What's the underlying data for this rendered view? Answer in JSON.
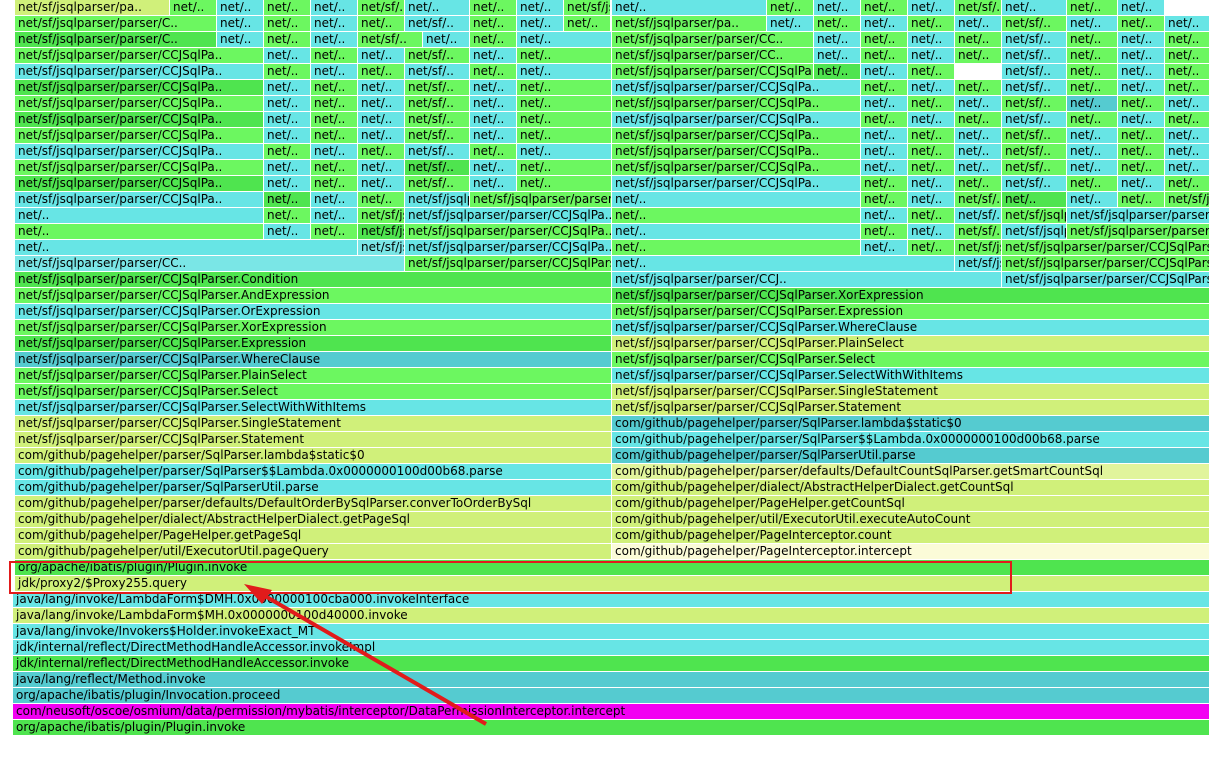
{
  "palette": {
    "lime": "#6cf760",
    "lime2": "#4fe44f",
    "cyan": "#67e5e5",
    "teal": "#55cbd0",
    "cyan2": "#7ae6e6",
    "yellow": "#d0f07a",
    "yellow2": "#e1f49c",
    "cream": "#fbfbd8",
    "magenta": "#f200f2"
  },
  "highlight_color": "#e11b1b",
  "frames": [
    {
      "t": "net/sf/jsqlparser/pa..",
      "c": "yellow"
    },
    {
      "t": "net/..",
      "c": "lime"
    },
    {
      "t": "net/..",
      "c": "cyan"
    },
    {
      "t": "net/..",
      "c": "lime"
    },
    {
      "t": "net/..",
      "c": "cyan"
    },
    {
      "t": "net/sf/..",
      "c": "lime"
    },
    {
      "t": "net/..",
      "c": "cyan"
    },
    {
      "t": "net/..",
      "c": "lime"
    },
    {
      "t": "net/..",
      "c": "cyan"
    },
    {
      "t": "net/sf/jsqlparser/pa..",
      "c": "lime"
    },
    {
      "t": "net/..",
      "c": "cyan"
    },
    {
      "t": "net/..",
      "c": "lime"
    },
    {
      "t": "net/..",
      "c": "cyan"
    },
    {
      "t": "net/..",
      "c": "lime"
    },
    {
      "t": "net/..",
      "c": "cyan"
    },
    {
      "t": "net/sf/..",
      "c": "lime"
    },
    {
      "t": "net/..",
      "c": "cyan"
    },
    {
      "t": "net/..",
      "c": "lime"
    },
    {
      "t": "net/..",
      "c": "cyan"
    },
    {
      "t": "net/sf/jsqlparser/parser/C..",
      "c": "lime"
    },
    {
      "t": "net/..",
      "c": "cyan"
    },
    {
      "t": "net/..",
      "c": "lime"
    },
    {
      "t": "net/..",
      "c": "cyan"
    },
    {
      "t": "net/..",
      "c": "lime"
    },
    {
      "t": "net/sf/..",
      "c": "cyan"
    },
    {
      "t": "net/..",
      "c": "lime"
    },
    {
      "t": "net/..",
      "c": "cyan"
    },
    {
      "t": "net/..",
      "c": "lime"
    },
    {
      "t": "net/sf/jsqlparser/pa..",
      "c": "lime"
    },
    {
      "t": "net/..",
      "c": "cyan"
    },
    {
      "t": "net/..",
      "c": "lime"
    },
    {
      "t": "net/..",
      "c": "cyan"
    },
    {
      "t": "net/..",
      "c": "lime"
    },
    {
      "t": "net/..",
      "c": "cyan"
    },
    {
      "t": "net/sf/..",
      "c": "lime"
    },
    {
      "t": "net/..",
      "c": "cyan"
    },
    {
      "t": "net/..",
      "c": "lime"
    },
    {
      "t": "net/..",
      "c": "cyan"
    },
    {
      "t": "net/sf/jsqlparser/parser/C..",
      "c": "lime2"
    },
    {
      "t": "net/..",
      "c": "cyan"
    },
    {
      "t": "net/..",
      "c": "lime"
    },
    {
      "t": "net/..",
      "c": "cyan"
    },
    {
      "t": "net/sf/..",
      "c": "lime"
    },
    {
      "t": "net/..",
      "c": "cyan"
    },
    {
      "t": "net/..",
      "c": "lime"
    },
    {
      "t": "net/..",
      "c": "cyan"
    },
    {
      "t": "net/sf/jsqlparser/parser/CC..",
      "c": "lime"
    },
    {
      "t": "net/..",
      "c": "cyan"
    },
    {
      "t": "net/..",
      "c": "lime"
    },
    {
      "t": "net/..",
      "c": "cyan"
    },
    {
      "t": "net/..",
      "c": "lime"
    },
    {
      "t": "net/sf/..",
      "c": "cyan"
    },
    {
      "t": "net/..",
      "c": "lime"
    },
    {
      "t": "net/..",
      "c": "cyan"
    },
    {
      "t": "net/..",
      "c": "lime"
    },
    {
      "t": "net/sf/jsqlparser/parser/CCJSqlPa..",
      "c": "lime"
    },
    {
      "t": "net/..",
      "c": "cyan"
    },
    {
      "t": "net/..",
      "c": "lime"
    },
    {
      "t": "net/..",
      "c": "cyan"
    },
    {
      "t": "net/sf/..",
      "c": "lime"
    },
    {
      "t": "net/..",
      "c": "cyan"
    },
    {
      "t": "net/..",
      "c": "lime"
    },
    {
      "t": "net/sf/jsqlparser/parser/CC..",
      "c": "lime"
    },
    {
      "t": "net/..",
      "c": "cyan"
    },
    {
      "t": "net/..",
      "c": "lime"
    },
    {
      "t": "net/..",
      "c": "cyan"
    },
    {
      "t": "net/..",
      "c": "lime"
    },
    {
      "t": "net/sf/..",
      "c": "cyan"
    },
    {
      "t": "net/..",
      "c": "lime"
    },
    {
      "t": "net/..",
      "c": "cyan"
    },
    {
      "t": "net/..",
      "c": "lime"
    },
    {
      "t": "net/sf/jsqlparser/parser/CCJSqlPa..",
      "c": "cyan"
    },
    {
      "t": "net/..",
      "c": "lime"
    },
    {
      "t": "net/..",
      "c": "cyan"
    },
    {
      "t": "net/..",
      "c": "lime"
    },
    {
      "t": "net/sf/..",
      "c": "cyan"
    },
    {
      "t": "net/..",
      "c": "lime"
    },
    {
      "t": "net/..",
      "c": "cyan"
    },
    {
      "t": "net/sf/jsqlparser/parser/CCJSqlPa..",
      "c": "lime"
    },
    {
      "t": "net/..",
      "c": "lime2"
    },
    {
      "t": "net/..",
      "c": "cyan"
    },
    {
      "t": "net/..",
      "c": "lime"
    },
    {
      "t": "net/sf/..",
      "c": "cyan"
    },
    {
      "t": "net/..",
      "c": "lime"
    },
    {
      "t": "net/..",
      "c": "cyan"
    },
    {
      "t": "net/..",
      "c": "lime"
    },
    {
      "t": "net/sf/jsqlparser/parser/CCJSqlPa..",
      "c": "lime2"
    },
    {
      "t": "net/..",
      "c": "cyan"
    },
    {
      "t": "net/..",
      "c": "lime"
    },
    {
      "t": "net/..",
      "c": "cyan"
    },
    {
      "t": "net/sf/..",
      "c": "lime"
    },
    {
      "t": "net/..",
      "c": "cyan"
    },
    {
      "t": "net/..",
      "c": "lime"
    },
    {
      "t": "net/sf/jsqlparser/parser/CCJSqlPa..",
      "c": "cyan"
    },
    {
      "t": "net/..",
      "c": "lime"
    },
    {
      "t": "net/..",
      "c": "cyan"
    },
    {
      "t": "net/..",
      "c": "lime"
    },
    {
      "t": "net/sf/..",
      "c": "cyan"
    },
    {
      "t": "net/..",
      "c": "lime"
    },
    {
      "t": "net/..",
      "c": "cyan"
    },
    {
      "t": "net/..",
      "c": "lime"
    },
    {
      "t": "net/sf/jsqlparser/parser/CCJSqlPa..",
      "c": "lime"
    },
    {
      "t": "net/..",
      "c": "cyan"
    },
    {
      "t": "net/..",
      "c": "lime"
    },
    {
      "t": "net/..",
      "c": "cyan"
    },
    {
      "t": "net/sf/..",
      "c": "lime"
    },
    {
      "t": "net/..",
      "c": "cyan"
    },
    {
      "t": "net/..",
      "c": "lime"
    },
    {
      "t": "net/sf/jsqlparser/parser/CCJSqlPa..",
      "c": "lime"
    },
    {
      "t": "net/..",
      "c": "cyan"
    },
    {
      "t": "net/..",
      "c": "lime"
    },
    {
      "t": "net/..",
      "c": "cyan"
    },
    {
      "t": "net/sf/..",
      "c": "lime"
    },
    {
      "t": "net/..",
      "c": "teal"
    },
    {
      "t": "net/..",
      "c": "lime"
    },
    {
      "t": "net/..",
      "c": "cyan"
    },
    {
      "t": "net/sf/jsqlparser/parser/CCJSqlPa..",
      "c": "lime2"
    },
    {
      "t": "net/..",
      "c": "cyan"
    },
    {
      "t": "net/..",
      "c": "lime"
    },
    {
      "t": "net/..",
      "c": "cyan"
    },
    {
      "t": "net/sf/..",
      "c": "lime"
    },
    {
      "t": "net/..",
      "c": "cyan"
    },
    {
      "t": "net/..",
      "c": "lime"
    },
    {
      "t": "net/sf/jsqlparser/parser/CCJSqlPa..",
      "c": "cyan"
    },
    {
      "t": "net/..",
      "c": "lime"
    },
    {
      "t": "net/..",
      "c": "cyan"
    },
    {
      "t": "net/..",
      "c": "lime"
    },
    {
      "t": "net/sf/..",
      "c": "cyan"
    },
    {
      "t": "net/..",
      "c": "lime"
    },
    {
      "t": "net/..",
      "c": "cyan"
    },
    {
      "t": "net/..",
      "c": "lime"
    },
    {
      "t": "net/sf/jsqlparser/parser/CCJSqlPa..",
      "c": "lime"
    },
    {
      "t": "net/..",
      "c": "cyan"
    },
    {
      "t": "net/..",
      "c": "lime"
    },
    {
      "t": "net/..",
      "c": "cyan"
    },
    {
      "t": "net/sf/..",
      "c": "lime"
    },
    {
      "t": "net/..",
      "c": "cyan"
    },
    {
      "t": "net/..",
      "c": "lime"
    },
    {
      "t": "net/sf/jsqlparser/parser/CCJSqlPa..",
      "c": "lime"
    },
    {
      "t": "net/..",
      "c": "cyan"
    },
    {
      "t": "net/..",
      "c": "lime"
    },
    {
      "t": "net/..",
      "c": "cyan"
    },
    {
      "t": "net/sf/..",
      "c": "lime"
    },
    {
      "t": "net/..",
      "c": "cyan"
    },
    {
      "t": "net/..",
      "c": "lime"
    },
    {
      "t": "net/..",
      "c": "cyan"
    },
    {
      "t": "net/sf/jsqlparser/parser/CCJSqlPa..",
      "c": "cyan"
    },
    {
      "t": "net/..",
      "c": "lime"
    },
    {
      "t": "net/..",
      "c": "cyan"
    },
    {
      "t": "net/..",
      "c": "lime"
    },
    {
      "t": "net/sf/..",
      "c": "cyan"
    },
    {
      "t": "net/..",
      "c": "lime"
    },
    {
      "t": "net/..",
      "c": "cyan"
    },
    {
      "t": "net/sf/jsqlparser/parser/CCJSqlPa..",
      "c": "lime"
    },
    {
      "t": "net/..",
      "c": "cyan"
    },
    {
      "t": "net/..",
      "c": "lime"
    },
    {
      "t": "net/..",
      "c": "cyan"
    },
    {
      "t": "net/sf/..",
      "c": "lime"
    },
    {
      "t": "net/..",
      "c": "cyan"
    },
    {
      "t": "net/..",
      "c": "lime"
    },
    {
      "t": "net/..",
      "c": "cyan"
    },
    {
      "t": "net/sf/jsqlparser/parser/CCJSqlPa..",
      "c": "lime"
    },
    {
      "t": "net/..",
      "c": "cyan"
    },
    {
      "t": "net/..",
      "c": "lime"
    },
    {
      "t": "net/..",
      "c": "cyan"
    },
    {
      "t": "net/sf/..",
      "c": "lime2"
    },
    {
      "t": "net/..",
      "c": "cyan"
    },
    {
      "t": "net/..",
      "c": "lime"
    },
    {
      "t": "net/sf/jsqlparser/parser/CCJSqlPa..",
      "c": "lime"
    },
    {
      "t": "net/..",
      "c": "cyan"
    },
    {
      "t": "net/..",
      "c": "lime"
    },
    {
      "t": "net/..",
      "c": "cyan"
    },
    {
      "t": "net/sf/..",
      "c": "lime"
    },
    {
      "t": "net/..",
      "c": "cyan"
    },
    {
      "t": "net/..",
      "c": "lime"
    },
    {
      "t": "net/..",
      "c": "cyan"
    },
    {
      "t": "net/sf/jsqlparser/parser/CCJSqlPa..",
      "c": "lime2"
    },
    {
      "t": "net/..",
      "c": "cyan"
    },
    {
      "t": "net/..",
      "c": "lime"
    },
    {
      "t": "net/..",
      "c": "cyan"
    },
    {
      "t": "net/sf/..",
      "c": "lime"
    },
    {
      "t": "net/..",
      "c": "cyan"
    },
    {
      "t": "net/..",
      "c": "lime"
    },
    {
      "t": "net/sf/jsqlparser/parser/CCJSqlPa..",
      "c": "cyan"
    },
    {
      "t": "net/..",
      "c": "lime"
    },
    {
      "t": "net/..",
      "c": "cyan"
    },
    {
      "t": "net/..",
      "c": "lime"
    },
    {
      "t": "net/sf/..",
      "c": "cyan"
    },
    {
      "t": "net/..",
      "c": "lime"
    },
    {
      "t": "net/..",
      "c": "cyan"
    },
    {
      "t": "net/..",
      "c": "lime"
    },
    {
      "t": "net/sf/jsqlparser/parser/CCJSqlPa..",
      "c": "cyan"
    },
    {
      "t": "net/..",
      "c": "lime2"
    },
    {
      "t": "net/..",
      "c": "cyan"
    },
    {
      "t": "net/..",
      "c": "lime"
    },
    {
      "t": "net/sf/jsqlparser/..",
      "c": "cyan"
    },
    {
      "t": "net/sf/jsqlparser/parser/CCJSqlPa..",
      "c": "lime"
    },
    {
      "t": "net/..",
      "c": "cyan"
    },
    {
      "t": "net/..",
      "c": "lime"
    },
    {
      "t": "net/..",
      "c": "cyan"
    },
    {
      "t": "net/sf/..",
      "c": "lime"
    },
    {
      "t": "net/..",
      "c": "lime2"
    },
    {
      "t": "net/..",
      "c": "cyan"
    },
    {
      "t": "net/..",
      "c": "lime"
    },
    {
      "t": "net/sf/jsqlparser/parser/CCJSqlPa..",
      "c": "lime"
    },
    {
      "t": "net/..",
      "c": "cyan"
    },
    {
      "t": "net/..",
      "c": "lime"
    },
    {
      "t": "net/..",
      "c": "cyan"
    },
    {
      "t": "net/sf/jsqlparser/parser/C..",
      "c": "lime"
    },
    {
      "t": "net/sf/jsqlparser/parser/CCJSqlPa..",
      "c": "cyan"
    },
    {
      "t": "net/..",
      "c": "lime"
    },
    {
      "t": "net/..",
      "c": "cyan"
    },
    {
      "t": "net/..",
      "c": "lime"
    },
    {
      "t": "net/sf/..",
      "c": "cyan"
    },
    {
      "t": "net/sf/jsqlparser/..",
      "c": "lime"
    },
    {
      "t": "net/sf/jsqlparser/parser/CCJSqlPa..",
      "c": "cyan"
    },
    {
      "t": "net/..",
      "c": "lime"
    },
    {
      "t": "net/..",
      "c": "cyan"
    },
    {
      "t": "net/..",
      "c": "lime"
    },
    {
      "t": "net/sf/jsqlparser/parser/CC..",
      "c": "lime2"
    },
    {
      "t": "net/sf/jsqlparser/parser/CCJSqlPa..",
      "c": "lime"
    },
    {
      "t": "net/..",
      "c": "cyan"
    },
    {
      "t": "net/..",
      "c": "lime"
    },
    {
      "t": "net/..",
      "c": "cyan"
    },
    {
      "t": "net/sf/..",
      "c": "lime"
    },
    {
      "t": "net/sf/jsqlparser/..",
      "c": "cyan"
    },
    {
      "t": "net/sf/jsqlparser/parser/CCJSqlParser.SQLCondi..",
      "c": "lime"
    },
    {
      "t": "net/..",
      "c": "cyan"
    },
    {
      "t": "net/sf/jsqlparser/parser/CC..",
      "c": "cyan2"
    },
    {
      "t": "net/sf/jsqlparser/parser/CCJSqlPa..",
      "c": "cyan"
    },
    {
      "t": "net/..",
      "c": "lime"
    },
    {
      "t": "net/..",
      "c": "cyan"
    },
    {
      "t": "net/..",
      "c": "lime"
    },
    {
      "t": "net/sf/jsqlparser/parser/CCJ..",
      "c": "lime"
    },
    {
      "t": "net/sf/jsqlparser/parser/CCJSqlParser.Condition",
      "c": "lime"
    },
    {
      "t": "net/sf/jsqlparser/parser/CC..",
      "c": "cyan2"
    },
    {
      "t": "net/sf/jsqlparser/parser/CCJSqlParser.SQLCondi..",
      "c": "lime"
    },
    {
      "t": "net/..",
      "c": "cyan"
    },
    {
      "t": "net/sf/jsqlparser/parser/CCJ..",
      "c": "cyan"
    },
    {
      "t": "net/sf/jsqlparser/parser/CCJSqlParser.AndExpression",
      "c": "lime"
    },
    {
      "t": "net/sf/jsqlparser/parser/CCJSqlParser.Condition",
      "c": "lime2"
    },
    {
      "t": "net/sf/jsqlparser/parser/CCJ..",
      "c": "cyan"
    },
    {
      "t": "net/sf/jsqlparser/parser/CCJSqlParser.OrExpression",
      "c": "cyan"
    },
    {
      "t": "net/sf/jsqlparser/parser/CCJSqlParser.AndExpression",
      "c": "lime"
    },
    {
      "t": "net/sf/jsqlparser/parser/CCJSqlParser.XorExpression",
      "c": "lime2"
    },
    {
      "t": "net/sf/jsqlparser/parser/CCJSqlParser.OrExpression",
      "c": "cyan"
    },
    {
      "t": "net/sf/jsqlparser/parser/CCJSqlParser.Expression",
      "c": "lime"
    },
    {
      "t": "net/sf/jsqlparser/parser/CCJSqlParser.XorExpression",
      "c": "lime"
    },
    {
      "t": "net/sf/jsqlparser/parser/CCJSqlParser.WhereClause",
      "c": "cyan"
    },
    {
      "t": "net/sf/jsqlparser/parser/CCJSqlParser.Expression",
      "c": "lime2"
    },
    {
      "t": "net/sf/jsqlparser/parser/CCJSqlParser.PlainSelect",
      "c": "yellow"
    },
    {
      "t": "net/sf/jsqlparser/parser/CCJSqlParser.WhereClause",
      "c": "teal"
    },
    {
      "t": "net/sf/jsqlparser/parser/CCJSqlParser.Select",
      "c": "lime"
    },
    {
      "t": "net/sf/jsqlparser/parser/CCJSqlParser.PlainSelect",
      "c": "lime"
    },
    {
      "t": "net/sf/jsqlparser/parser/CCJSqlParser.SelectWithWithItems",
      "c": "cyan"
    },
    {
      "t": "net/sf/jsqlparser/parser/CCJSqlParser.Select",
      "c": "lime"
    },
    {
      "t": "net/sf/jsqlparser/parser/CCJSqlParser.SingleStatement",
      "c": "yellow"
    },
    {
      "t": "net/sf/jsqlparser/parser/CCJSqlParser.SelectWithWithItems",
      "c": "cyan"
    },
    {
      "t": "net/sf/jsqlparser/parser/CCJSqlParser.Statement",
      "c": "yellow"
    },
    {
      "t": "net/sf/jsqlparser/parser/CCJSqlParser.SingleStatement",
      "c": "yellow"
    },
    {
      "t": "com/github/pagehelper/parser/SqlParser.lambda$static$0",
      "c": "teal"
    },
    {
      "t": "net/sf/jsqlparser/parser/CCJSqlParser.Statement",
      "c": "yellow"
    },
    {
      "t": "com/github/pagehelper/parser/SqlParser$$Lambda.0x0000000100d00b68.parse",
      "c": "cyan"
    },
    {
      "t": "com/github/pagehelper/parser/SqlParser.lambda$static$0",
      "c": "yellow"
    },
    {
      "t": "com/github/pagehelper/parser/SqlParserUtil.parse",
      "c": "teal"
    },
    {
      "t": "com/github/pagehelper/parser/SqlParser$$Lambda.0x0000000100d00b68.parse",
      "c": "cyan"
    },
    {
      "t": "com/github/pagehelper/parser/defaults/DefaultCountSqlParser.getSmartCountSql",
      "c": "yellow2"
    },
    {
      "t": "com/github/pagehelper/parser/SqlParserUtil.parse",
      "c": "cyan"
    },
    {
      "t": "com/github/pagehelper/dialect/AbstractHelperDialect.getCountSql",
      "c": "yellow"
    },
    {
      "t": "com/github/pagehelper/parser/defaults/DefaultOrderBySqlParser.converToOrderBySql",
      "c": "yellow"
    },
    {
      "t": "com/github/pagehelper/PageHelper.getCountSql",
      "c": "yellow"
    },
    {
      "t": "com/github/pagehelper/dialect/AbstractHelperDialect.getPageSql",
      "c": "yellow"
    },
    {
      "t": "com/github/pagehelper/util/ExecutorUtil.executeAutoCount",
      "c": "yellow"
    },
    {
      "t": "com/github/pagehelper/PageHelper.getPageSql",
      "c": "yellow"
    },
    {
      "t": "com/github/pagehelper/PageInterceptor.count",
      "c": "yellow"
    },
    {
      "t": "com/github/pagehelper/util/ExecutorUtil.pageQuery",
      "c": "yellow"
    },
    {
      "t": "com/github/pagehelper/PageInterceptor.intercept",
      "c": "cream"
    },
    {
      "t": "org/apache/ibatis/plugin/Plugin.invoke",
      "c": "lime2"
    },
    {
      "t": "jdk/proxy2/$Proxy255.query",
      "c": "yellow"
    },
    {
      "t": "java/lang/invoke/LambdaForm$DMH.0x0000000100cba000.invokeInterface",
      "c": "cyan"
    },
    {
      "t": "java/lang/invoke/LambdaForm$MH.0x0000000100d40000.invoke",
      "c": "yellow"
    },
    {
      "t": "java/lang/invoke/Invokers$Holder.invokeExact_MT",
      "c": "cyan"
    },
    {
      "t": "jdk/internal/reflect/DirectMethodHandleAccessor.invokeImpl",
      "c": "cyan"
    },
    {
      "t": "jdk/internal/reflect/DirectMethodHandleAccessor.invoke",
      "c": "lime2"
    },
    {
      "t": "java/lang/reflect/Method.invoke",
      "c": "teal"
    },
    {
      "t": "org/apache/ibatis/plugin/Invocation.proceed",
      "c": "teal"
    },
    {
      "t": "com/neusoft/oscoe/osmium/data/permission/mybatis/interceptor/DataPermissionInterceptor.intercept",
      "c": "magenta"
    },
    {
      "t": "org/apache/ibatis/plugin/Plugin.invoke",
      "c": "lime2"
    }
  ]
}
